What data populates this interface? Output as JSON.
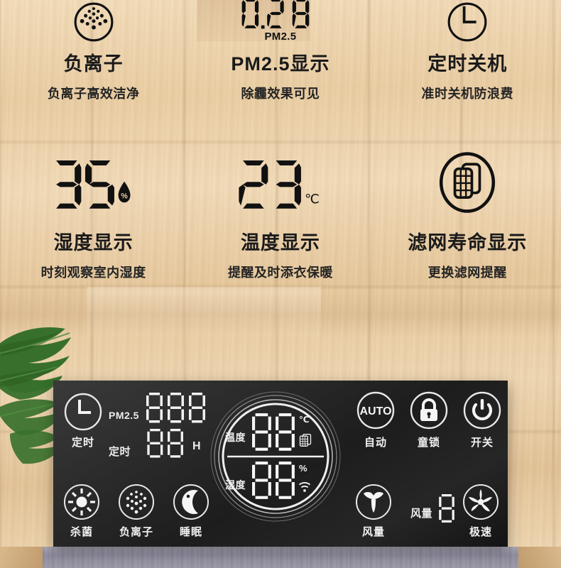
{
  "features": [
    {
      "id": "anion",
      "icon": "anion-dots-circle-icon",
      "title": "负离子",
      "subtitle": "负离子高效洁净"
    },
    {
      "id": "pm25",
      "icon": "pm25-lcd-readout",
      "value": "0.28",
      "unit_label": "PM2.5",
      "title": "PM2.5显示",
      "subtitle": "除霾效果可见"
    },
    {
      "id": "timer-off",
      "icon": "clock-circle-icon",
      "title": "定时关机",
      "subtitle": "准时关机防浪费"
    },
    {
      "id": "humidity",
      "icon": "humidity-lcd-readout",
      "value": "35",
      "unit_label": "%",
      "title": "湿度显示",
      "subtitle": "时刻观察室内湿度"
    },
    {
      "id": "temperature",
      "icon": "temperature-lcd-readout",
      "value": "23",
      "unit_label": "℃",
      "title": "温度显示",
      "subtitle": "提醒及时添衣保暖"
    },
    {
      "id": "filter-life",
      "icon": "filter-circle-icon",
      "title": "滤网寿命显示",
      "subtitle": "更换滤网提醒"
    }
  ],
  "panel": {
    "timer_button": {
      "label": "定时",
      "icon": "clock-icon"
    },
    "pm25_row": {
      "label": "PM2.5",
      "digits": "888"
    },
    "timer_row": {
      "label": "定时",
      "digits": "88",
      "unit": "H"
    },
    "center_display": {
      "temperature": {
        "label": "温度",
        "digits": "88",
        "unit": "℃"
      },
      "humidity": {
        "label": "湿度",
        "digits": "88",
        "unit": "%"
      },
      "filter_icon": "filter-icon",
      "wifi_icon": "wifi-icon"
    },
    "buttons_right_top": [
      {
        "label": "自动",
        "icon": "auto-icon",
        "icon_text": "AUTO"
      },
      {
        "label": "童锁",
        "icon": "lock-icon"
      },
      {
        "label": "开关",
        "icon": "power-icon"
      }
    ],
    "buttons_left_bottom": [
      {
        "label": "杀菌",
        "icon": "sterilize-sun-icon"
      },
      {
        "label": "负离子",
        "icon": "anion-dots-icon"
      },
      {
        "label": "睡眠",
        "icon": "moon-icon"
      }
    ],
    "fan": {
      "button_label": "风量",
      "icon": "fan-3-blade-icon",
      "readout_label": "风量",
      "readout_digits": "8"
    },
    "turbo": {
      "label": "极速",
      "icon": "turbo-fan-icon"
    }
  },
  "colors": {
    "panel_bg": "#1d1d1d",
    "panel_text": "#f2f2f2",
    "wood": "#e9cda3",
    "ink": "#1a1a1a",
    "leaf": "#3e7a33"
  }
}
